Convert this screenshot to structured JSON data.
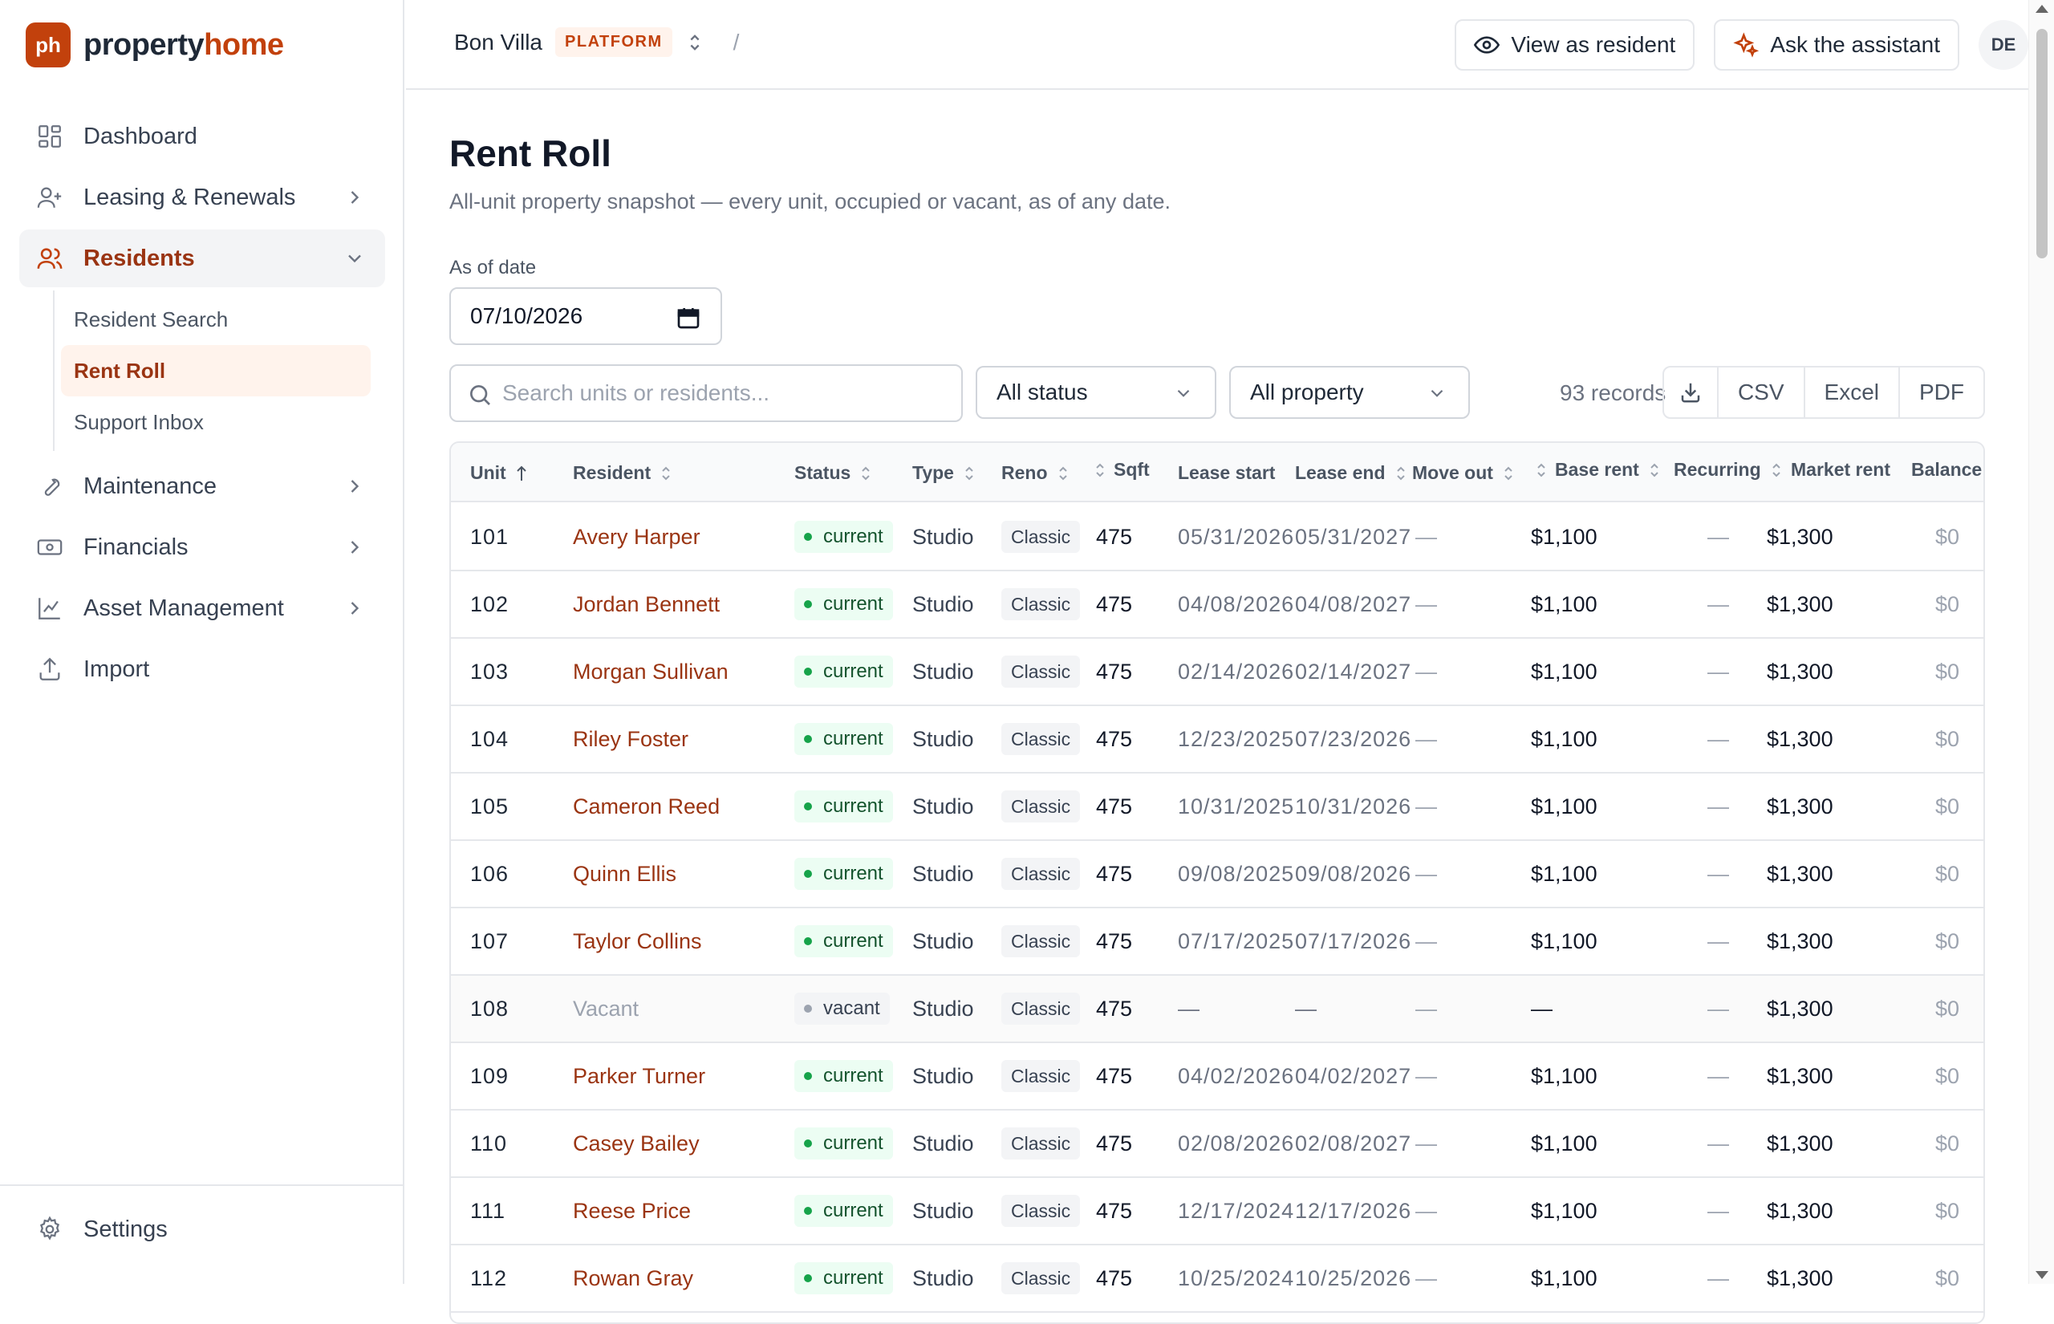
{
  "brand": {
    "logo_mark": "ph",
    "name_prefix": "property",
    "name_suffix": "home",
    "accent_color": "#c2410c"
  },
  "sidebar": {
    "items": [
      {
        "label": "Dashboard",
        "icon": "dashboard-icon"
      },
      {
        "label": "Leasing & Renewals",
        "icon": "user-plus-icon"
      },
      {
        "label": "Residents",
        "icon": "users-icon"
      },
      {
        "label": "Maintenance",
        "icon": "wrench-icon"
      },
      {
        "label": "Financials",
        "icon": "banknote-icon"
      },
      {
        "label": "Asset Management",
        "icon": "chart-line-icon"
      },
      {
        "label": "Import",
        "icon": "upload-icon"
      }
    ],
    "sub_items": [
      {
        "label": "Resident Search"
      },
      {
        "label": "Rent Roll"
      },
      {
        "label": "Support Inbox"
      }
    ],
    "settings_label": "Settings"
  },
  "topbar": {
    "property_name": "Bon Villa",
    "property_badge": "PLATFORM",
    "breadcrumb_sep": "/",
    "view_as_resident": "View as resident",
    "ask_assistant": "Ask the assistant",
    "avatar_initials": "DE"
  },
  "page": {
    "title": "Rent Roll",
    "subtitle": "All-unit property snapshot — every unit, occupied or vacant, as of any date.",
    "date_label": "As of date",
    "date_value": "07/10/2026",
    "search_placeholder": "Search units or residents...",
    "status_filter": "All status",
    "property_filter": "All property",
    "records": "93 records",
    "export": {
      "csv": "CSV",
      "excel": "Excel",
      "pdf": "PDF"
    }
  },
  "table": {
    "headers": {
      "unit": "Unit",
      "resident": "Resident",
      "status": "Status",
      "type": "Type",
      "reno": "Reno",
      "sqft": "Sqft",
      "lease_start": "Lease start",
      "lease_end": "Lease end",
      "move_out": "Move out",
      "base_rent": "Base rent",
      "recurring": "Recurring",
      "market_rent": "Market rent",
      "balance": "Balance"
    },
    "rows": [
      {
        "unit": "101",
        "resident": "Avery Harper",
        "status": "current",
        "type": "Studio",
        "reno": "Classic",
        "sqft": "475",
        "lease_start": "05/31/2026",
        "lease_end": "05/31/2027",
        "move_out": "—",
        "base_rent": "$1,100",
        "recurring": "—",
        "market_rent": "$1,300",
        "balance": "$0"
      },
      {
        "unit": "102",
        "resident": "Jordan Bennett",
        "status": "current",
        "type": "Studio",
        "reno": "Classic",
        "sqft": "475",
        "lease_start": "04/08/2026",
        "lease_end": "04/08/2027",
        "move_out": "—",
        "base_rent": "$1,100",
        "recurring": "—",
        "market_rent": "$1,300",
        "balance": "$0"
      },
      {
        "unit": "103",
        "resident": "Morgan Sullivan",
        "status": "current",
        "type": "Studio",
        "reno": "Classic",
        "sqft": "475",
        "lease_start": "02/14/2026",
        "lease_end": "02/14/2027",
        "move_out": "—",
        "base_rent": "$1,100",
        "recurring": "—",
        "market_rent": "$1,300",
        "balance": "$0"
      },
      {
        "unit": "104",
        "resident": "Riley Foster",
        "status": "current",
        "type": "Studio",
        "reno": "Classic",
        "sqft": "475",
        "lease_start": "12/23/2025",
        "lease_end": "07/23/2026",
        "move_out": "—",
        "base_rent": "$1,100",
        "recurring": "—",
        "market_rent": "$1,300",
        "balance": "$0"
      },
      {
        "unit": "105",
        "resident": "Cameron Reed",
        "status": "current",
        "type": "Studio",
        "reno": "Classic",
        "sqft": "475",
        "lease_start": "10/31/2025",
        "lease_end": "10/31/2026",
        "move_out": "—",
        "base_rent": "$1,100",
        "recurring": "—",
        "market_rent": "$1,300",
        "balance": "$0"
      },
      {
        "unit": "106",
        "resident": "Quinn Ellis",
        "status": "current",
        "type": "Studio",
        "reno": "Classic",
        "sqft": "475",
        "lease_start": "09/08/2025",
        "lease_end": "09/08/2026",
        "move_out": "—",
        "base_rent": "$1,100",
        "recurring": "—",
        "market_rent": "$1,300",
        "balance": "$0"
      },
      {
        "unit": "107",
        "resident": "Taylor Collins",
        "status": "current",
        "type": "Studio",
        "reno": "Classic",
        "sqft": "475",
        "lease_start": "07/17/2025",
        "lease_end": "07/17/2026",
        "move_out": "—",
        "base_rent": "$1,100",
        "recurring": "—",
        "market_rent": "$1,300",
        "balance": "$0"
      },
      {
        "unit": "108",
        "resident": "Vacant",
        "status": "vacant",
        "type": "Studio",
        "reno": "Classic",
        "sqft": "475",
        "lease_start": "—",
        "lease_end": "—",
        "move_out": "—",
        "base_rent": "—",
        "recurring": "—",
        "market_rent": "$1,300",
        "balance": "$0"
      },
      {
        "unit": "109",
        "resident": "Parker Turner",
        "status": "current",
        "type": "Studio",
        "reno": "Classic",
        "sqft": "475",
        "lease_start": "04/02/2026",
        "lease_end": "04/02/2027",
        "move_out": "—",
        "base_rent": "$1,100",
        "recurring": "—",
        "market_rent": "$1,300",
        "balance": "$0"
      },
      {
        "unit": "110",
        "resident": "Casey Bailey",
        "status": "current",
        "type": "Studio",
        "reno": "Classic",
        "sqft": "475",
        "lease_start": "02/08/2026",
        "lease_end": "02/08/2027",
        "move_out": "—",
        "base_rent": "$1,100",
        "recurring": "—",
        "market_rent": "$1,300",
        "balance": "$0"
      },
      {
        "unit": "111",
        "resident": "Reese Price",
        "status": "current",
        "type": "Studio",
        "reno": "Classic",
        "sqft": "475",
        "lease_start": "12/17/2024",
        "lease_end": "12/17/2026",
        "move_out": "—",
        "base_rent": "$1,100",
        "recurring": "—",
        "market_rent": "$1,300",
        "balance": "$0"
      },
      {
        "unit": "112",
        "resident": "Rowan Gray",
        "status": "current",
        "type": "Studio",
        "reno": "Classic",
        "sqft": "475",
        "lease_start": "10/25/2024",
        "lease_end": "10/25/2026",
        "move_out": "—",
        "base_rent": "$1,100",
        "recurring": "—",
        "market_rent": "$1,300",
        "balance": "$0"
      }
    ]
  }
}
